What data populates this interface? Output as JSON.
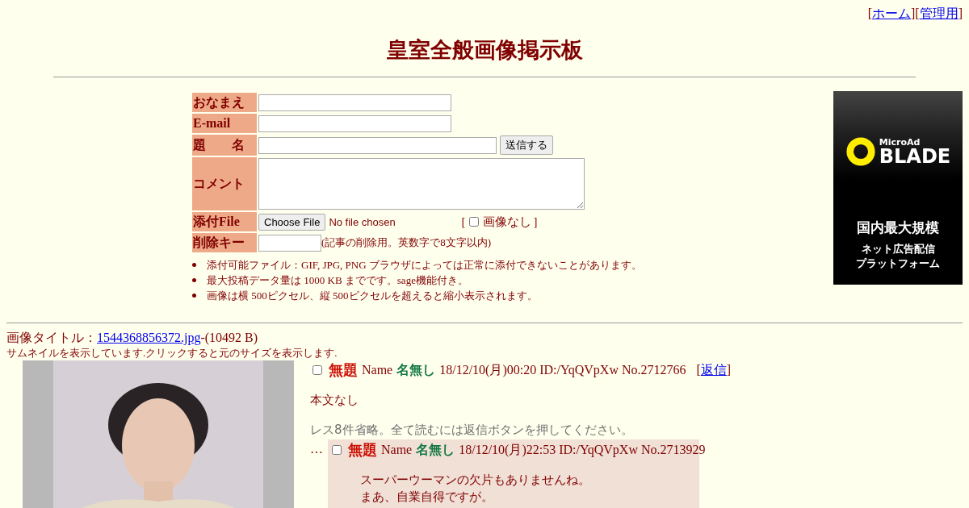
{
  "top_links": [
    {
      "open": "[",
      "label": "ホーム",
      "close": "]"
    },
    {
      "open": "[",
      "label": "管理用",
      "close": "]"
    }
  ],
  "title": "皇室全般画像掲示板",
  "form": {
    "rows": [
      {
        "kind": "text",
        "label": "おなまえ"
      },
      {
        "kind": "text",
        "label": "E-mail"
      },
      {
        "kind": "subject",
        "label": "題　　名",
        "button": "送信する"
      },
      {
        "kind": "textarea",
        "label": "コメント"
      },
      {
        "kind": "file",
        "label": "添付File",
        "button": "Choose File",
        "status": "No file chosen",
        "noimage_open": "[",
        "noimage_label": "画像なし",
        "noimage_close": "]",
        "noimage_checked": false
      },
      {
        "kind": "key",
        "label": "削除キー",
        "note": "(記事の削除用。英数字で8文字以内)"
      }
    ],
    "notes": [
      "添付可能ファイル：GIF, JPG, PNG ブラウザによっては正常に添付できないことがあります。",
      "最大投稿データ量は 1000 KB までです。sage機能付き。",
      "画像は横 500ピクセル、縦 500ピクセルを超えると縮小表示されます。"
    ]
  },
  "ad": {
    "brand_small": "MicroAd",
    "brand": "BLADE",
    "headline": "国内最大規模",
    "lines": [
      "ネット広告配信",
      "プラットフォーム"
    ]
  },
  "image_info": {
    "label": "画像タイトル：",
    "filename": "1544368856372.jpg",
    "size": "-(10492 B)",
    "thumb_note": "サムネイルを表示しています.クリックすると元のサイズを表示します."
  },
  "thread": {
    "checked": false,
    "subject": "無題",
    "name_label": "Name",
    "name": "名無し",
    "date": "18/12/10(月)00:20 ID:/YqQVpXw No.2712766",
    "reply_open": "[",
    "reply_link": "返信",
    "reply_close": "]",
    "body": [
      "本文なし"
    ],
    "omitted": "レス8件省略。全て読むには返信ボタンを押してください。",
    "replies": [
      {
        "marker": "…",
        "checked": false,
        "subject": "無題",
        "name_label": "Name",
        "name": "名無し",
        "date": "18/12/10(月)22:53 ID:/YqQVpXw No.2713929",
        "body": [
          "スーパーウーマンの欠片もありませんね。",
          "まあ、自業自得ですが。"
        ]
      }
    ]
  }
}
